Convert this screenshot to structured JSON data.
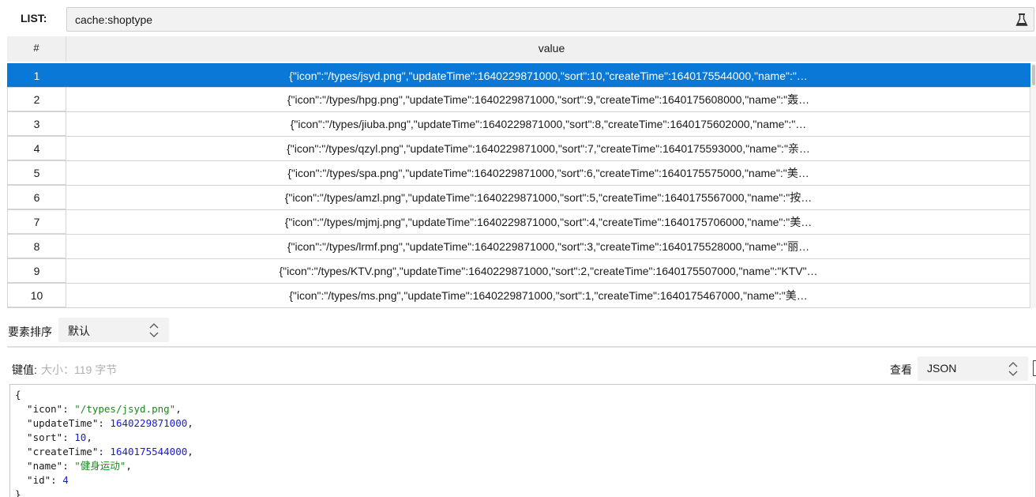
{
  "key_bar": {
    "label": "LIST:",
    "key": "cache:shoptype",
    "clear_icon": "flask-icon"
  },
  "table": {
    "headers": {
      "index": "#",
      "value": "value"
    },
    "selected_index": 0,
    "rows": [
      {
        "index": "1",
        "value": "{\"icon\":\"/types/jsyd.png\",\"updateTime\":1640229871000,\"sort\":10,\"createTime\":1640175544000,\"name\":\"…"
      },
      {
        "index": "2",
        "value": "{\"icon\":\"/types/hpg.png\",\"updateTime\":1640229871000,\"sort\":9,\"createTime\":1640175608000,\"name\":\"轰…"
      },
      {
        "index": "3",
        "value": "{\"icon\":\"/types/jiuba.png\",\"updateTime\":1640229871000,\"sort\":8,\"createTime\":1640175602000,\"name\":\"…"
      },
      {
        "index": "4",
        "value": "{\"icon\":\"/types/qzyl.png\",\"updateTime\":1640229871000,\"sort\":7,\"createTime\":1640175593000,\"name\":\"亲…"
      },
      {
        "index": "5",
        "value": "{\"icon\":\"/types/spa.png\",\"updateTime\":1640229871000,\"sort\":6,\"createTime\":1640175575000,\"name\":\"美…"
      },
      {
        "index": "6",
        "value": "{\"icon\":\"/types/amzl.png\",\"updateTime\":1640229871000,\"sort\":5,\"createTime\":1640175567000,\"name\":\"按…"
      },
      {
        "index": "7",
        "value": "{\"icon\":\"/types/mjmj.png\",\"updateTime\":1640229871000,\"sort\":4,\"createTime\":1640175706000,\"name\":\"美…"
      },
      {
        "index": "8",
        "value": "{\"icon\":\"/types/lrmf.png\",\"updateTime\":1640229871000,\"sort\":3,\"createTime\":1640175528000,\"name\":\"丽…"
      },
      {
        "index": "9",
        "value": "{\"icon\":\"/types/KTV.png\",\"updateTime\":1640229871000,\"sort\":2,\"createTime\":1640175507000,\"name\":\"KTV\"…"
      },
      {
        "index": "10",
        "value": "{\"icon\":\"/types/ms.png\",\"updateTime\":1640229871000,\"sort\":1,\"createTime\":1640175467000,\"name\":\"美…"
      }
    ]
  },
  "sort": {
    "label": "要素排序",
    "value": "默认"
  },
  "value_panel": {
    "label": "键值:",
    "size_text": "大小：119 字节",
    "view_label": "查看",
    "view_mode": "JSON"
  },
  "editor": {
    "lines": [
      [
        {
          "t": "p",
          "v": "{"
        }
      ],
      [
        {
          "t": "p",
          "v": "  \"icon\": "
        },
        {
          "t": "s",
          "v": "\"/types/jsyd.png\""
        },
        {
          "t": "p",
          "v": ","
        }
      ],
      [
        {
          "t": "p",
          "v": "  \"updateTime\": "
        },
        {
          "t": "n",
          "v": "1640229871000"
        },
        {
          "t": "p",
          "v": ","
        }
      ],
      [
        {
          "t": "p",
          "v": "  \"sort\": "
        },
        {
          "t": "n",
          "v": "10"
        },
        {
          "t": "p",
          "v": ","
        }
      ],
      [
        {
          "t": "p",
          "v": "  \"createTime\": "
        },
        {
          "t": "n",
          "v": "1640175544000"
        },
        {
          "t": "p",
          "v": ","
        }
      ],
      [
        {
          "t": "p",
          "v": "  \"name\": "
        },
        {
          "t": "s",
          "v": "\"健身运动\""
        },
        {
          "t": "p",
          "v": ","
        }
      ],
      [
        {
          "t": "p",
          "v": "  \"id\": "
        },
        {
          "t": "n",
          "v": "4"
        }
      ],
      [
        {
          "t": "p",
          "v": "}"
        }
      ]
    ]
  },
  "colors": {
    "selection": "#0a78d7",
    "json_string": "#1a8a1a",
    "json_number": "#1a1adb"
  }
}
